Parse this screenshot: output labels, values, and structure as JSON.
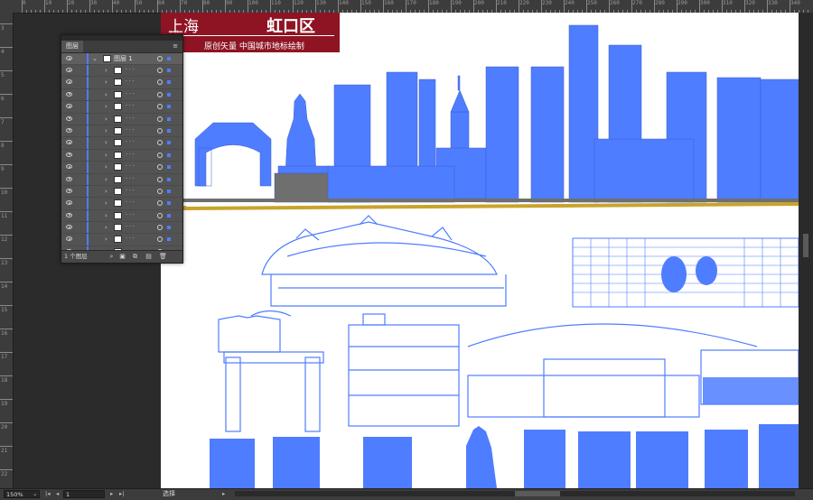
{
  "ruler_top": {
    "ticks": [
      "0",
      "10",
      "20",
      "30",
      "40",
      "50",
      "60",
      "70",
      "80",
      "90",
      "100",
      "110",
      "120",
      "130",
      "140",
      "150",
      "160",
      "170",
      "180",
      "190",
      "200",
      "210",
      "220",
      "230",
      "240",
      "250",
      "260",
      "270",
      "280",
      "290",
      "300",
      "310",
      "320",
      "330",
      "340",
      "350"
    ]
  },
  "ruler_left": {
    "ticks": [
      "3",
      "4",
      "5",
      "6",
      "7",
      "8",
      "9",
      "10",
      "11",
      "12",
      "13",
      "14",
      "15",
      "16",
      "17",
      "18",
      "19",
      "20",
      "21",
      "22"
    ]
  },
  "banner": {
    "left_text": "上海",
    "right_text": "虹口区",
    "subtitle": "原创矢量  中国城市地标绘制"
  },
  "layers_panel": {
    "tab_label": "图层",
    "top_layer_name": "图层 1",
    "sublayer_count": 16,
    "footer_count": "1 个图层",
    "accent": "#4f7dff"
  },
  "statusbar": {
    "zoom": "150%",
    "artboard": "1",
    "tool": "选择"
  },
  "colors": {
    "building": "#4f7dff",
    "banner": "#8e1423",
    "ground_gold": "#c9a42a",
    "ground_gray": "#6f6f6f"
  }
}
